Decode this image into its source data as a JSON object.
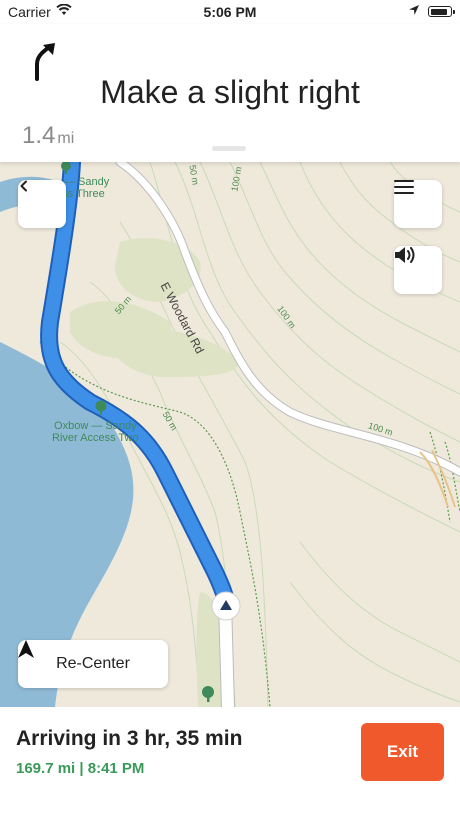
{
  "status_bar": {
    "carrier": "Carrier",
    "time": "5:06 PM",
    "wifi_icon": "wifi-icon",
    "location_icon": "location-arrow-icon",
    "battery_level": 0.9
  },
  "banner": {
    "maneuver_icon": "slight-right-arrow-icon",
    "instruction": "Make a slight right",
    "distance_value": "1.4",
    "distance_unit": "mi"
  },
  "map": {
    "labels": {
      "poi_top_line1": "— Sandy",
      "poi_top_line2": "ess Three",
      "poi_mid_line1": "Oxbow — Sandy",
      "poi_mid_line2": "River Access Two",
      "road_name": "E Woodard Rd",
      "contour_50_a": "50 m",
      "contour_100_a": "100 m",
      "contour_50_b": "50 m",
      "contour_100_b": "100 m",
      "contour_50_c": "50 m",
      "contour_100_c": "100 m"
    },
    "colors": {
      "land": "#efe9dc",
      "river": "#8fbad6",
      "route": "#3d8fe8",
      "road": "#ffffff",
      "park": "#d9dfc0",
      "contour": "#b8d0a6"
    }
  },
  "buttons": {
    "back_icon": "chevron-left-icon",
    "menu_icon": "hamburger-menu-icon",
    "sound_icon": "speaker-icon",
    "recenter_icon": "navigation-arrow-icon",
    "recenter_label": "Re-Center"
  },
  "footer": {
    "arriving": "Arriving in 3 hr, 35 min",
    "trip_info": "169.7 mi | 8:41 PM",
    "exit_label": "Exit",
    "exit_color": "#f0592b"
  }
}
